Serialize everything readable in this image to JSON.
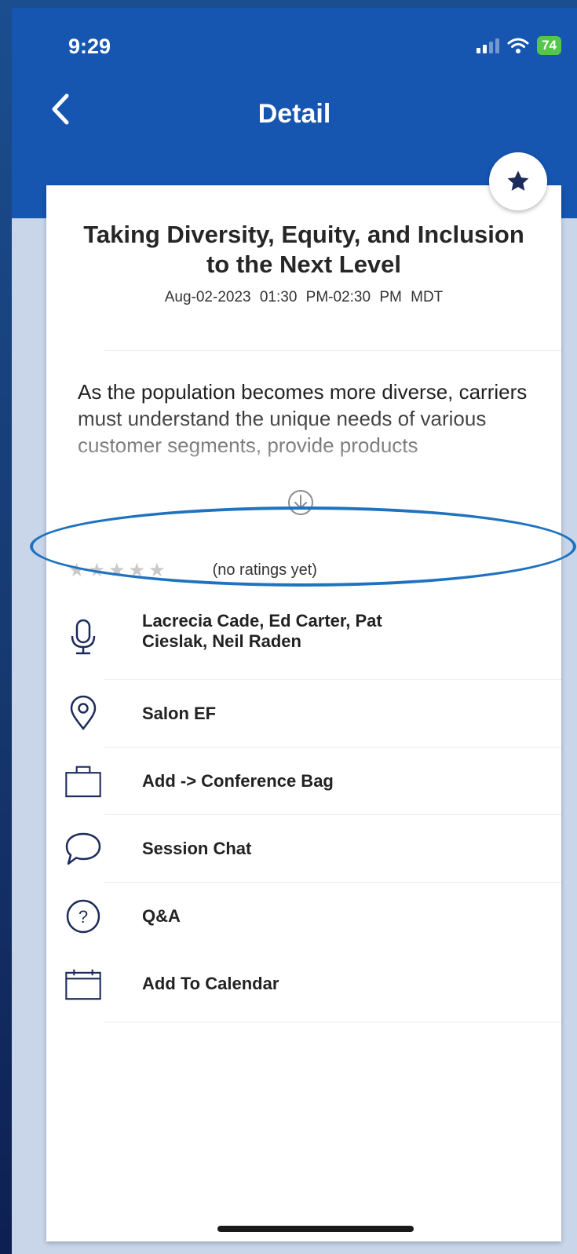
{
  "status_bar": {
    "time": "9:29",
    "battery": "74"
  },
  "header": {
    "title": "Detail"
  },
  "session": {
    "title_line1": "Taking Diversity, Equity, and Inclusion",
    "title_line2": "to the Next Level",
    "time": "Aug-02-2023   01:30 PM-02:30 PM MDT",
    "description": "As the population becomes more diverse, carriers must understand the unique needs of various customer segments, provide products"
  },
  "rating": {
    "stars": "★★★★★",
    "text": "(no ratings yet)"
  },
  "items": [
    {
      "icon": "microphone-icon",
      "label_line1": "Lacrecia Cade, Ed Carter, Pat",
      "label_line2": "Cieslak, Neil Raden"
    },
    {
      "icon": "location-pin-icon",
      "label": "Salon EF"
    },
    {
      "icon": "bag-icon",
      "label": "Add -> Conference Bag"
    },
    {
      "icon": "chat-bubble-icon",
      "label": "Session Chat"
    },
    {
      "icon": "question-circle-icon",
      "label": "Q&A"
    },
    {
      "icon": "calendar-icon",
      "label": "Add To Calendar"
    }
  ],
  "colors": {
    "header": "#1656b0",
    "highlight": "#1f72c0",
    "icon": "#1d2b5c"
  }
}
